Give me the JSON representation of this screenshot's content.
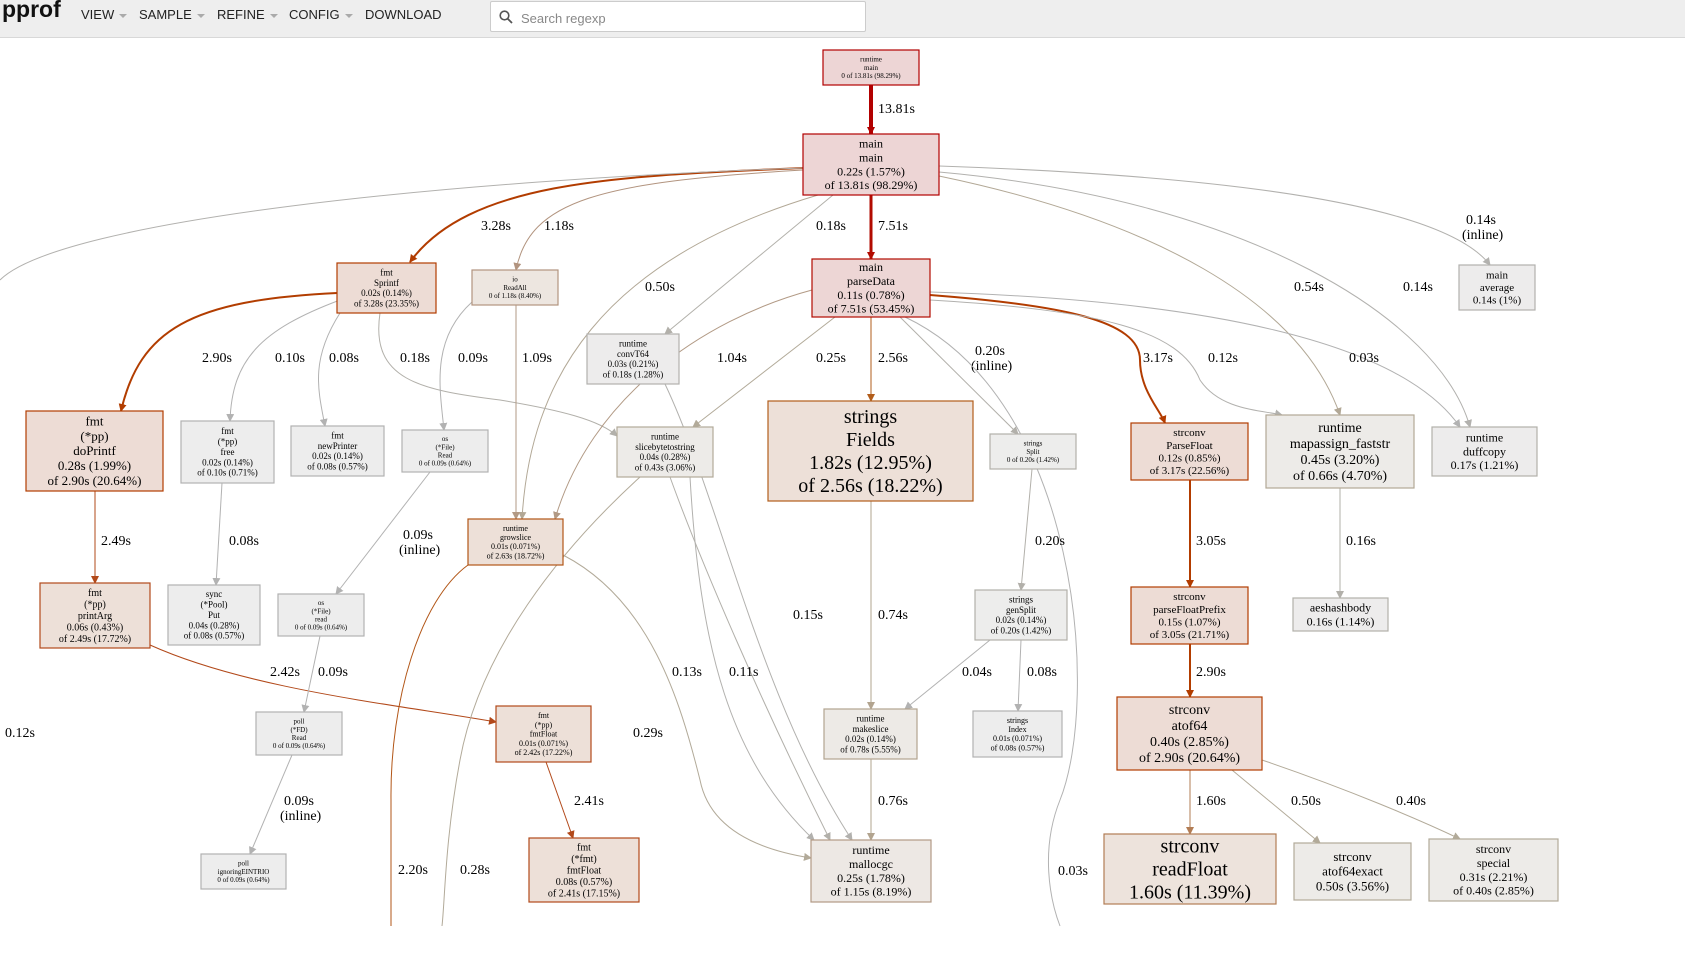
{
  "app": {
    "title": "pprof"
  },
  "menu": [
    {
      "label": "VIEW",
      "caret": true
    },
    {
      "label": "SAMPLE",
      "caret": true
    },
    {
      "label": "REFINE",
      "caret": true
    },
    {
      "label": "CONFIG",
      "caret": true
    },
    {
      "label": "DOWNLOAD",
      "caret": false
    }
  ],
  "search": {
    "placeholder": "Search regexp",
    "value": ""
  },
  "colors": {
    "hot": "#b20000",
    "warm": "#b23c00",
    "cool": "#b2aa99",
    "neutral": "#b2b2b2"
  },
  "graph": {
    "nodes": [
      {
        "id": "runtime-main",
        "lines": [
          "runtime",
          "main",
          "0 of 13.81s (98.29%)"
        ],
        "fill": "#edd5d5",
        "stroke": "#b20000"
      },
      {
        "id": "main-main",
        "lines": [
          "main",
          "main",
          "0.22s (1.57%)",
          "of 13.81s (98.29%)"
        ],
        "fill": "#edd5d5",
        "stroke": "#b20000"
      },
      {
        "id": "fmt-sprintf",
        "lines": [
          "fmt",
          "Sprintf",
          "0.02s (0.14%)",
          "of 3.28s (23.35%)"
        ],
        "fill": "#eddcd5",
        "stroke": "#b23c00"
      },
      {
        "id": "io-readall",
        "lines": [
          "io",
          "ReadAll",
          "0 of 1.18s (8.40%)"
        ],
        "fill": "#ede6e0",
        "stroke": "#b2947f"
      },
      {
        "id": "main-parsedata",
        "lines": [
          "main",
          "parseData",
          "0.11s (0.78%)",
          "of 7.51s (53.45%)"
        ],
        "fill": "#edd6d5",
        "stroke": "#b20b00"
      },
      {
        "id": "main-average",
        "lines": [
          "main",
          "average",
          "0.14s (1%)"
        ],
        "fill": "#edecec",
        "stroke": "#b2b1ae"
      },
      {
        "id": "runtime-convt64",
        "lines": [
          "runtime",
          "convT64",
          "0.03s (0.21%)",
          "of 0.18s (1.28%)"
        ],
        "fill": "#edecec",
        "stroke": "#b2b1ae"
      },
      {
        "id": "fmt-pp-doprintf",
        "lines": [
          "fmt",
          "(*pp)",
          "doPrintf",
          "0.28s (1.99%)",
          "of 2.90s (20.64%)"
        ],
        "fill": "#eddcd5",
        "stroke": "#b23d00"
      },
      {
        "id": "fmt-pp-free",
        "lines": [
          "fmt",
          "(*pp)",
          "free",
          "0.02s (0.14%)",
          "of 0.10s (0.71%)"
        ],
        "fill": "#ededed",
        "stroke": "#b2b2b2"
      },
      {
        "id": "fmt-newprinter",
        "lines": [
          "fmt",
          "newPrinter",
          "0.02s (0.14%)",
          "of 0.08s (0.57%)"
        ],
        "fill": "#ededed",
        "stroke": "#b2b2b2"
      },
      {
        "id": "os-file-read",
        "lines": [
          "os",
          "(*File)",
          "Read",
          "0 of 0.09s (0.64%)"
        ],
        "fill": "#ededed",
        "stroke": "#b2b2b2"
      },
      {
        "id": "runtime-slicebytetostring",
        "lines": [
          "runtime",
          "slicebytetostring",
          "0.04s (0.28%)",
          "of 0.43s (3.06%)"
        ],
        "fill": "#edebe8",
        "stroke": "#b2aa99"
      },
      {
        "id": "strings-fields",
        "lines": [
          "strings",
          "Fields",
          "1.82s (12.95%)",
          "of 2.56s (18.22%)"
        ],
        "fill": "#ede0d8",
        "stroke": "#b25d1b"
      },
      {
        "id": "strings-split",
        "lines": [
          "strings",
          "Split",
          "0 of 0.20s (1.42%)"
        ],
        "fill": "#ededec",
        "stroke": "#b2b0aa"
      },
      {
        "id": "strconv-parsefloat",
        "lines": [
          "strconv",
          "ParseFloat",
          "0.12s (0.85%)",
          "of 3.17s (22.56%)"
        ],
        "fill": "#eddcd5",
        "stroke": "#b23c00"
      },
      {
        "id": "runtime-mapassign",
        "lines": [
          "runtime",
          "mapassign_faststr",
          "0.45s (3.20%)",
          "of 0.66s (4.70%)"
        ],
        "fill": "#edebe8",
        "stroke": "#b2a896"
      },
      {
        "id": "runtime-duffcopy",
        "lines": [
          "runtime",
          "duffcopy",
          "0.17s (1.21%)"
        ],
        "fill": "#edecec",
        "stroke": "#b2b0aa"
      },
      {
        "id": "runtime-growslice",
        "lines": [
          "runtime",
          "growslice",
          "0.01s (0.071%)",
          "of 2.63s (18.72%)"
        ],
        "fill": "#ede0d8",
        "stroke": "#b25617"
      },
      {
        "id": "fmt-pp-printarg",
        "lines": [
          "fmt",
          "(*pp)",
          "printArg",
          "0.06s (0.43%)",
          "of 2.49s (17.72%)"
        ],
        "fill": "#ede0d8",
        "stroke": "#b2491a"
      },
      {
        "id": "sync-pool-put",
        "lines": [
          "sync",
          "(*Pool)",
          "Put",
          "0.04s (0.28%)",
          "of 0.08s (0.57%)"
        ],
        "fill": "#ededed",
        "stroke": "#b2b2b2"
      },
      {
        "id": "os-file-read-lower",
        "lines": [
          "os",
          "(*File)",
          "read",
          "0 of 0.09s (0.64%)"
        ],
        "fill": "#ededed",
        "stroke": "#b2b2b2"
      },
      {
        "id": "strings-gensplit",
        "lines": [
          "strings",
          "genSplit",
          "0.02s (0.14%)",
          "of 0.20s (1.42%)"
        ],
        "fill": "#ededec",
        "stroke": "#b2b0aa"
      },
      {
        "id": "strconv-parsefloatprefix",
        "lines": [
          "strconv",
          "parseFloatPrefix",
          "0.15s (1.07%)",
          "of 3.05s (21.71%)"
        ],
        "fill": "#eddcd5",
        "stroke": "#b23c00"
      },
      {
        "id": "aeshashbody",
        "lines": [
          "aeshashbody",
          "0.16s (1.14%)"
        ],
        "fill": "#edecec",
        "stroke": "#b2b0aa"
      },
      {
        "id": "poll-fd-read",
        "lines": [
          "poll",
          "(*FD)",
          "Read",
          "0 of 0.09s (0.64%)"
        ],
        "fill": "#ededed",
        "stroke": "#b2b2b2"
      },
      {
        "id": "fmt-pp-fmtfloat",
        "lines": [
          "fmt",
          "(*pp)",
          "fmtFloat",
          "0.01s (0.071%)",
          "of 2.42s (17.22%)"
        ],
        "fill": "#ede0d8",
        "stroke": "#b2491a"
      },
      {
        "id": "runtime-makeslice",
        "lines": [
          "runtime",
          "makeslice",
          "0.02s (0.14%)",
          "of 0.78s (5.55%)"
        ],
        "fill": "#edeae6",
        "stroke": "#b2a48f"
      },
      {
        "id": "strings-index",
        "lines": [
          "strings",
          "Index",
          "0.01s (0.071%)",
          "of 0.08s (0.57%)"
        ],
        "fill": "#ededed",
        "stroke": "#b2b2b2"
      },
      {
        "id": "strconv-atof64",
        "lines": [
          "strconv",
          "atof64",
          "0.40s (2.85%)",
          "of 2.90s (20.64%)"
        ],
        "fill": "#eddcd5",
        "stroke": "#b23d00"
      },
      {
        "id": "poll-ignoringeintrio",
        "lines": [
          "poll",
          "ignoringEINTRIO",
          "0 of 0.09s (0.64%)"
        ],
        "fill": "#ededed",
        "stroke": "#b2b2b2"
      },
      {
        "id": "fmt-fmt-fmtfloat",
        "lines": [
          "fmt",
          "(*fmt)",
          "fmtFloat",
          "0.08s (0.57%)",
          "of 2.41s (17.15%)"
        ],
        "fill": "#ede0d8",
        "stroke": "#b2491a"
      },
      {
        "id": "runtime-mallocgc",
        "lines": [
          "runtime",
          "mallocgc",
          "0.25s (1.78%)",
          "of 1.15s (8.19%)"
        ],
        "fill": "#ede8e4",
        "stroke": "#b29a85"
      },
      {
        "id": "strconv-readfloat",
        "lines": [
          "strconv",
          "readFloat",
          "1.60s (11.39%)"
        ],
        "fill": "#ede3dc",
        "stroke": "#b27d55"
      },
      {
        "id": "strconv-atof64exact",
        "lines": [
          "strconv",
          "atof64exact",
          "0.50s (3.56%)"
        ],
        "fill": "#edebe8",
        "stroke": "#b2aa99"
      },
      {
        "id": "strconv-special",
        "lines": [
          "strconv",
          "special",
          "0.31s (2.21%)",
          "of 0.40s (2.85%)"
        ],
        "fill": "#edebe8",
        "stroke": "#b2aa99"
      }
    ],
    "edges": [
      {
        "id": "e-rt-main",
        "label": "13.81s",
        "color": "#b20000"
      },
      {
        "id": "e-main-sprintf",
        "label": "3.28s",
        "color": "#b23c00"
      },
      {
        "id": "e-main-readall",
        "label": "1.18s",
        "color": "#b2947f"
      },
      {
        "id": "e-main-convt64",
        "label": "0.18s",
        "color": "#b2b0aa"
      },
      {
        "id": "e-main-parsedata",
        "label": "7.51s",
        "color": "#b20b00"
      },
      {
        "id": "e-main-growslice",
        "label": "0.50s",
        "color": "#b2a896"
      },
      {
        "id": "e-main-average",
        "label": "0.14s (inline)",
        "color": "#b2b1ae"
      },
      {
        "id": "e-main-mapassign",
        "label": "0.54s",
        "color": "#b2a896"
      },
      {
        "id": "e-main-duffcopy",
        "label": "0.14s",
        "color": "#b2b1ae"
      },
      {
        "id": "e-main-left",
        "label": "0.12s",
        "color": "#b2b1ae"
      },
      {
        "id": "e-sprintf-doprintf",
        "label": "2.90s",
        "color": "#b23d00"
      },
      {
        "id": "e-sprintf-free",
        "label": "0.10s",
        "color": "#b2b2b2"
      },
      {
        "id": "e-sprintf-newprinter",
        "label": "0.08s",
        "color": "#b2b2b2"
      },
      {
        "id": "e-sprintf-slicebyte",
        "label": "0.18s",
        "color": "#b2b0aa"
      },
      {
        "id": "e-readall-osread",
        "label": "0.09s",
        "color": "#b2b2b2"
      },
      {
        "id": "e-readall-growslice",
        "label": "1.09s",
        "color": "#b29a85"
      },
      {
        "id": "e-parsedata-growslice",
        "label": "1.04s",
        "color": "#b29a85"
      },
      {
        "id": "e-parsedata-slicebyte",
        "label": "0.25s",
        "color": "#b2aa99"
      },
      {
        "id": "e-parsedata-fields",
        "label": "2.56s",
        "color": "#b25d1b"
      },
      {
        "id": "e-parsedata-split",
        "label": "0.20s (inline)",
        "color": "#b2b0aa"
      },
      {
        "id": "e-parsedata-parsefloat",
        "label": "3.17s",
        "color": "#b23c00"
      },
      {
        "id": "e-parsedata-mapassign",
        "label": "0.12s",
        "color": "#b2b1ae"
      },
      {
        "id": "e-parsedata-duffcopy",
        "label": "0.03s",
        "color": "#b2b2b2"
      },
      {
        "id": "e-parsedata-down",
        "label": "0.03s",
        "color": "#b2b2b2"
      },
      {
        "id": "e-doprintf-printarg",
        "label": "2.49s",
        "color": "#b2491a"
      },
      {
        "id": "e-free-put",
        "label": "0.08s",
        "color": "#b2b2b2"
      },
      {
        "id": "e-osread-read",
        "label": "0.09s (inline)",
        "color": "#b2b2b2"
      },
      {
        "id": "e-slicebyte-mallocgc",
        "label": "0.15s",
        "color": "#b2b0aa"
      },
      {
        "id": "e-fields-makeslice",
        "label": "0.74s",
        "color": "#b2a48f"
      },
      {
        "id": "e-split-gensplit",
        "label": "0.20s",
        "color": "#b2b0aa"
      },
      {
        "id": "e-parsefloat-prefix",
        "label": "3.05s",
        "color": "#b23c00"
      },
      {
        "id": "e-mapassign-aeshash",
        "label": "0.16s",
        "color": "#b2b0aa"
      },
      {
        "id": "e-printarg-fmtfloat",
        "label": "2.42s",
        "color": "#b2491a"
      },
      {
        "id": "e-osread2-pollread",
        "label": "0.09s",
        "color": "#b2b2b2"
      },
      {
        "id": "e-gensplit-makeslice",
        "label": "0.04s",
        "color": "#b2b2b2"
      },
      {
        "id": "e-gensplit-index",
        "label": "0.08s",
        "color": "#b2b2b2"
      },
      {
        "id": "e-prefix-atof64",
        "label": "2.90s",
        "color": "#b23d00"
      },
      {
        "id": "e-convt64-mallocgc",
        "label": "0.13s",
        "color": "#b2b1ae"
      },
      {
        "id": "e-slicebyte-mallocgc2",
        "label": "0.11s",
        "color": "#b2b1ae"
      },
      {
        "id": "e-growslice-mallocgc",
        "label": "0.29s",
        "color": "#b2aa99"
      },
      {
        "id": "e-pollread-ignoring",
        "label": "0.09s (inline)",
        "color": "#b2b2b2"
      },
      {
        "id": "e-fmtfloat-fmtfloat",
        "label": "2.41s",
        "color": "#b2491a"
      },
      {
        "id": "e-makeslice-mallocgc",
        "label": "0.76s",
        "color": "#b2a48f"
      },
      {
        "id": "e-atof64-readfloat",
        "label": "1.60s",
        "color": "#b27d55"
      },
      {
        "id": "e-atof64-exact",
        "label": "0.50s",
        "color": "#b2aa99"
      },
      {
        "id": "e-atof64-special",
        "label": "0.40s",
        "color": "#b2aa99"
      },
      {
        "id": "e-growslice-down",
        "label": "2.20s",
        "color": "#b25617"
      },
      {
        "id": "e-slicebyte-down",
        "label": "0.28s",
        "color": "#b2aa99"
      }
    ]
  }
}
